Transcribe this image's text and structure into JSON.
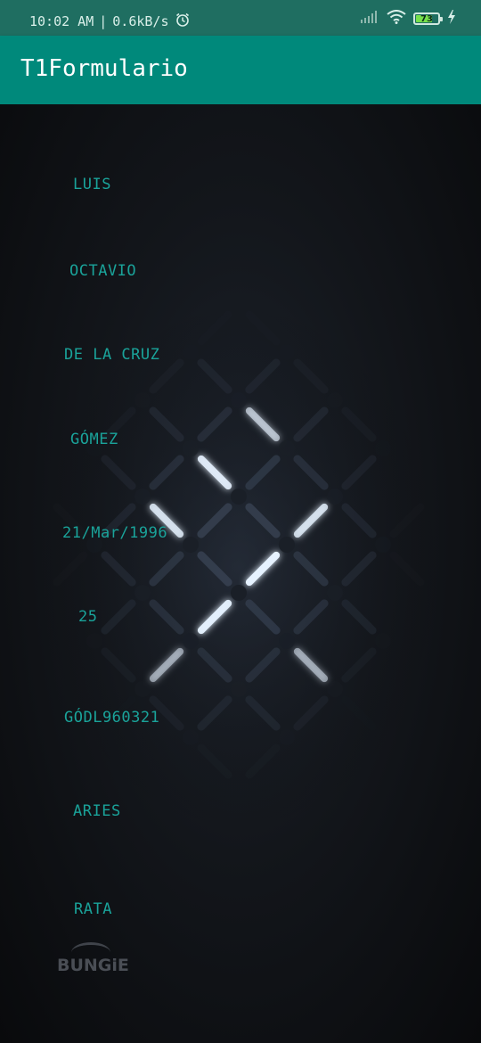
{
  "status_bar": {
    "time": "10:02 AM",
    "separator": "|",
    "network_speed": "0.6kB/s",
    "battery_level": "73",
    "battery_fraction": 0.73
  },
  "app_bar": {
    "title": "T1Formulario"
  },
  "form": {
    "nombre": "LUIS",
    "segundo_nombre": "OCTAVIO",
    "apellido_paterno": "DE LA CRUZ",
    "apellido_materno": "GÓMEZ",
    "fecha_nacimiento": "21/Mar/1996",
    "edad": "25",
    "rfc": "GÓDL960321",
    "signo_zodiacal": "ARIES",
    "signo_chino": "RATA"
  },
  "wallpaper": {
    "logo_text": "BUNGiE"
  },
  "colors": {
    "status_bar": "#1f6e61",
    "app_bar": "#00897b",
    "field_text": "#1aa39a",
    "background": "#0b0c0e"
  }
}
